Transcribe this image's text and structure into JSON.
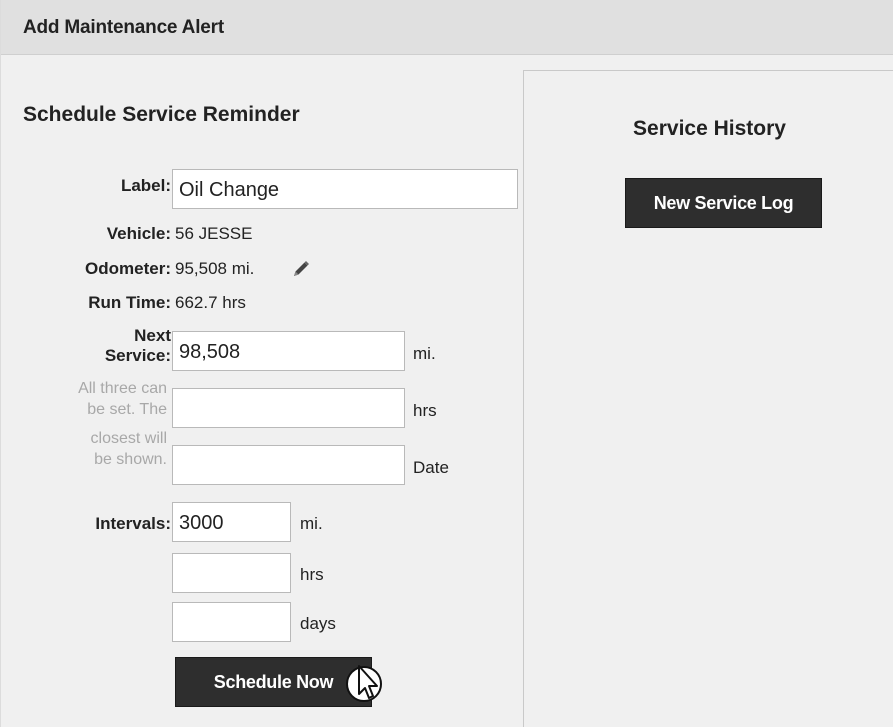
{
  "window": {
    "title": "Add Maintenance Alert"
  },
  "reminder": {
    "heading": "Schedule Service Reminder",
    "label_label": "Label:",
    "label_value": "Oil Change",
    "vehicle_label": "Vehicle:",
    "vehicle_value": "56 JESSE",
    "odometer_label": "Odometer:",
    "odometer_value": "95,508 mi.",
    "runtime_label": "Run Time:",
    "runtime_value": "662.7 hrs",
    "next_service_label_line1": "Next",
    "next_service_label_line2": "Service:",
    "next_service_miles_value": "98,508",
    "next_service_miles_unit": "mi.",
    "next_service_hours_value": "",
    "next_service_hours_unit": "hrs",
    "next_service_date_value": "",
    "next_service_date_unit": "Date",
    "hint_lines": [
      "All three can",
      "be set. The",
      "closest will",
      "be shown."
    ],
    "intervals_label": "Intervals:",
    "interval_miles_value": "3000",
    "interval_miles_unit": "mi.",
    "interval_hours_value": "",
    "interval_hours_unit": "hrs",
    "interval_days_value": "",
    "interval_days_unit": "days",
    "schedule_button_label": "Schedule Now"
  },
  "history": {
    "heading": "Service History",
    "new_log_button_label": "New Service Log"
  },
  "icons": {
    "edit": "pencil-icon",
    "cursor": "mouse-pointer-icon"
  },
  "colors": {
    "button_bg": "#2e2e2e",
    "panel_bg": "#f0f0f0",
    "titlebar_bg": "#e0e0e0",
    "hint_text": "#a8a8a8"
  }
}
